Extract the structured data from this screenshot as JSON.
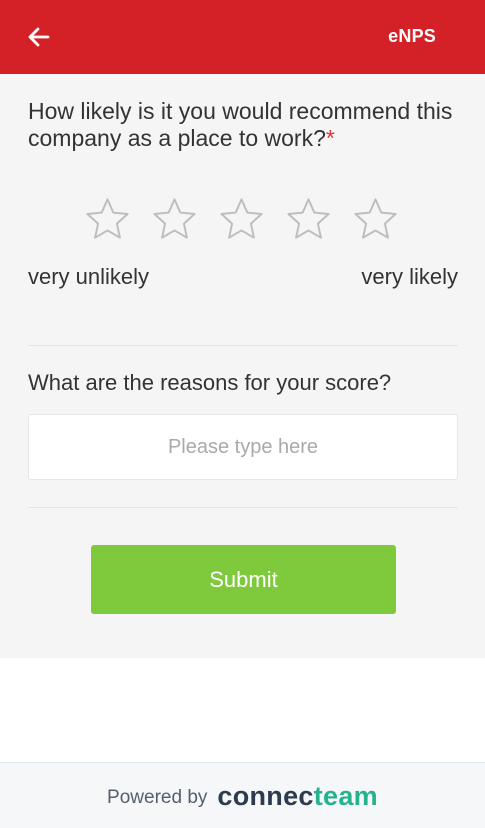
{
  "header": {
    "title": "eNPS",
    "back_icon": "arrow-left-icon",
    "background_color": "#d42127"
  },
  "survey": {
    "question_1": "How likely is it you would recommend this company as a place to work?",
    "required_marker": "*",
    "rating": {
      "max": 5,
      "selected": 0,
      "icon": "star-outline-icon",
      "low_label": "very unlikely",
      "high_label": "very likely"
    },
    "question_2": "What are the reasons for your score?",
    "reason_input": {
      "value": "",
      "placeholder": "Please type here"
    },
    "submit_label": "Submit",
    "submit_color": "#7fc93c"
  },
  "footer": {
    "powered_by": "Powered by",
    "brand_part_1": "connec",
    "brand_part_2": "team",
    "brand_colors": [
      "#2d3b4e",
      "#25b28f"
    ]
  }
}
